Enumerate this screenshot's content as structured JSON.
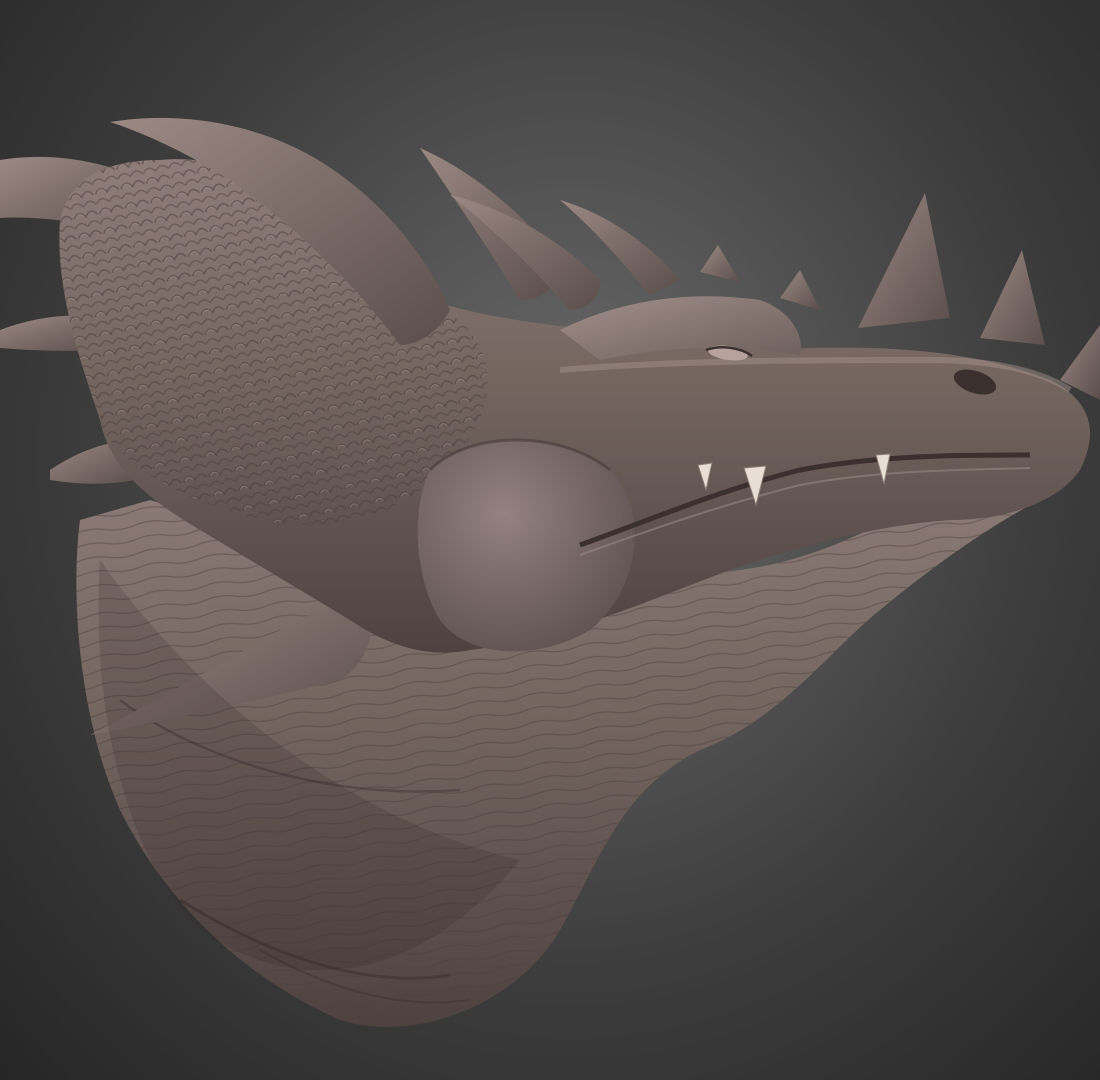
{
  "scene": {
    "subject": "dragon-head-sculpt",
    "background_colors": [
      "#6a6a6a",
      "#3d3d3d",
      "#262626"
    ],
    "clay_color": "#7a6b68",
    "clay_highlight": "#a18f8b",
    "clay_shadow": "#3e3432",
    "tooth_color": "#e7ded4"
  }
}
